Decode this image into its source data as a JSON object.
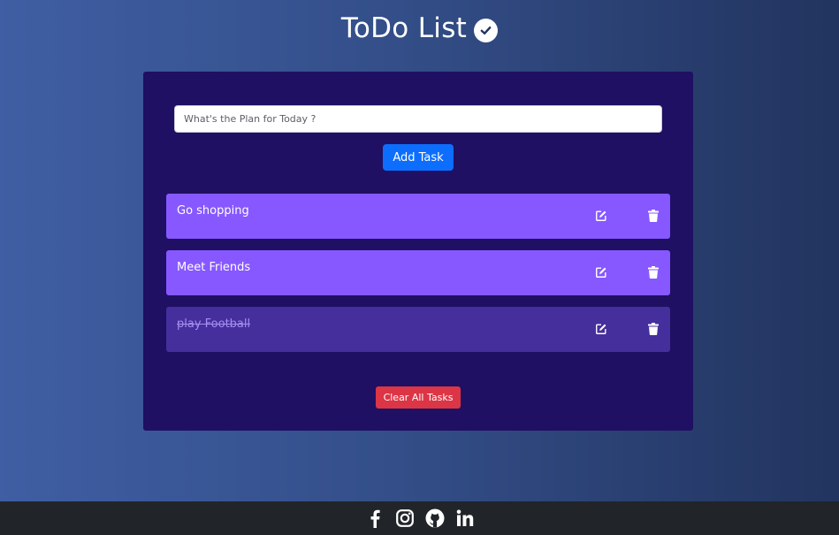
{
  "header": {
    "title": "ToDo List",
    "icon": "check-circle-icon"
  },
  "form": {
    "placeholder": "What's the Plan for Today ?",
    "value": "",
    "add_label": "Add Task"
  },
  "tasks": [
    {
      "text": "Go shopping",
      "completed": false
    },
    {
      "text": "Meet Friends",
      "completed": false
    },
    {
      "text": "play Football",
      "completed": true
    }
  ],
  "clear_label": "Clear All Tasks",
  "footer": {
    "icons": [
      "facebook-icon",
      "instagram-icon",
      "github-icon",
      "linkedin-icon"
    ]
  },
  "colors": {
    "card": "#1f1063",
    "task": "#8758ff",
    "task_done": "#452f9c",
    "primary": "#0d6efd",
    "danger": "#dc3545",
    "footer": "#212529"
  }
}
